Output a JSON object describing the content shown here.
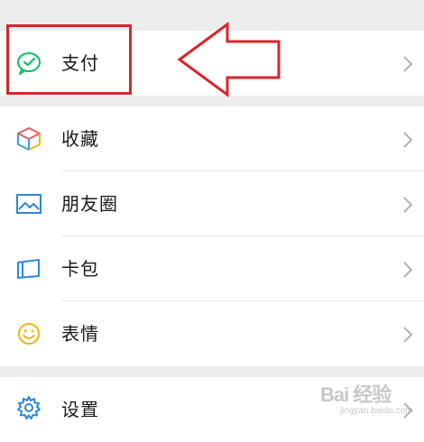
{
  "menu": {
    "items": [
      {
        "label": "支付",
        "icon": "wechat-pay-icon"
      },
      {
        "label": "收藏",
        "icon": "cube-icon"
      },
      {
        "label": "朋友圈",
        "icon": "picture-icon"
      },
      {
        "label": "卡包",
        "icon": "card-wallet-icon"
      },
      {
        "label": "表情",
        "icon": "smiley-icon"
      },
      {
        "label": "设置",
        "icon": "gear-icon"
      }
    ]
  },
  "watermark": {
    "main": "Bai 经验",
    "sub": "jingyan.baidu.com"
  },
  "colors": {
    "annotation": "#d8262a",
    "pay_green": "#07c160",
    "background": "#ededed",
    "row": "#ffffff"
  }
}
